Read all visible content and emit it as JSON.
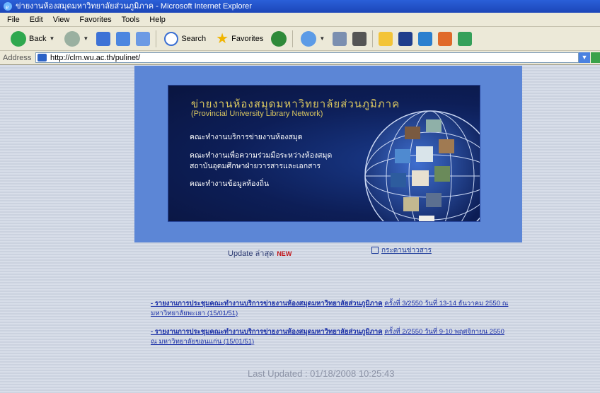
{
  "window": {
    "title": "ข่ายงานห้องสมุดมหาวิทยาลัยส่วนภูมิภาค - Microsoft Internet Explorer"
  },
  "menubar": [
    "File",
    "Edit",
    "View",
    "Favorites",
    "Tools",
    "Help"
  ],
  "toolbar": {
    "back": "Back",
    "search": "Search",
    "favorites": "Favorites"
  },
  "address": {
    "label": "Address",
    "url": "http://clm.wu.ac.th/pulinet/"
  },
  "banner": {
    "title": "ข่ายงานห้องสมุดมหาวิทยาลัยส่วนภูมิภาค",
    "subtitle": "(Provincial University Library Network)",
    "items": [
      "คณะทำงานบริการข่ายงานห้องสมุด",
      "คณะทำงานเพื่อความร่วมมือระหว่างห้องสมุด",
      "สถาบันอุดมศึกษาฝ่ายวารสารและเอกสาร",
      "คณะทำงานข้อมูลท้องถิ่น"
    ]
  },
  "update": {
    "label": "Update ล่าสุด",
    "badge": "NEW"
  },
  "messages_link": "กระดานข่าวสาร",
  "news": [
    {
      "bold": "- รายงานการประชุมคณะทำงานบริการข่ายงานห้องสมุดมหาวิทยาลัยส่วนภูมิภาค",
      "rest": "ครั้งที่ 3/2550 วันที่ 13-14 ธันวาคม 2550 ณ มหาวิทยาลัยพะเยา (15/01/51)"
    },
    {
      "bold": "- รายงานการประชุมคณะทำงานบริการข่ายงานห้องสมุดมหาวิทยาลัยส่วนภูมิภาค",
      "rest": "ครั้งที่ 2/2550 วันที่ 9-10 พฤศจิกายน 2550 ณ มหาวิทยาลัยขอนแก่น (15/01/51)"
    }
  ],
  "last_updated": "Last Updated : 01/18/2008 10:25:43",
  "colors": {
    "banner_title": "#d9c660",
    "link": "#1c31a8",
    "frame": "#5c86d6"
  }
}
